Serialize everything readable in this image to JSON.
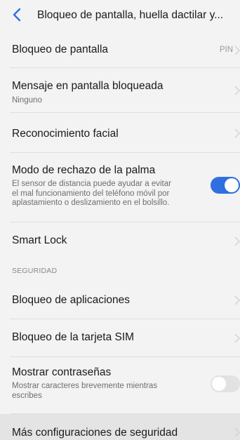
{
  "header": {
    "title": "Bloqueo de pantalla, huella dactilar y..."
  },
  "rows": [
    {
      "label": "Bloqueo de pantalla",
      "value": "PIN"
    },
    {
      "label": "Mensaje en pantalla bloqueada",
      "sub": "Ninguno"
    },
    {
      "label": "Reconocimiento facial"
    },
    {
      "label": "Modo de rechazo de la palma",
      "sub_lines": [
        "El sensor de distancia puede ayudar a evitar",
        "el mal funcionamiento del teléfono móvil por",
        "aplastamiento o deslizamiento en el bolsillo."
      ],
      "toggle": "on"
    },
    {
      "label": "Smart Lock"
    }
  ],
  "section": "SEGURIDAD",
  "security_rows": [
    {
      "label": "Bloqueo de aplicaciones"
    },
    {
      "label": "Bloqueo de la tarjeta SIM"
    },
    {
      "label": "Mostrar contraseñas",
      "sub_lines": [
        "Mostrar caracteres brevemente mientras",
        "escribes"
      ],
      "toggle": "off"
    },
    {
      "label": "Más configuraciones de seguridad"
    }
  ],
  "colors": {
    "accent": "#2f6fe0",
    "background": "#f3f3f3",
    "divider": "#dedede",
    "toggle_off": "#e2e2e2"
  },
  "icons": {
    "back": "chevron-left-icon",
    "row_arrow": "chevron-right-icon"
  }
}
